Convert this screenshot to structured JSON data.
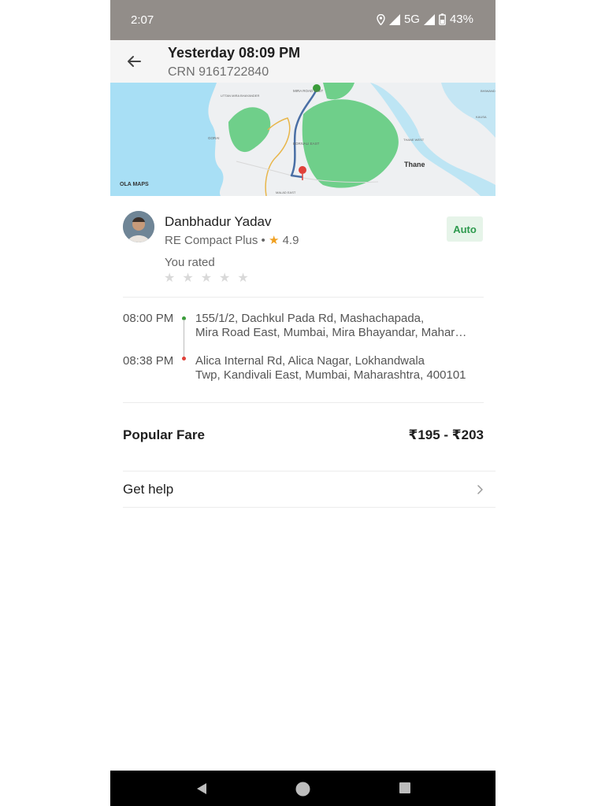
{
  "status_bar": {
    "time": "2:07",
    "network": "5G",
    "battery": "43%"
  },
  "header": {
    "title": "Yesterday 08:09 PM",
    "crn": "CRN 9161722840"
  },
  "map": {
    "brand": "OLA MAPS",
    "city_label": "Thane",
    "place_labels": [
      "MIRA ROAD EAST",
      "UTTAN MIRA BHAYANDER",
      "GORAI",
      "BORIVALI EAST",
      "THANE WEST",
      "MALAD EAST",
      "KAUSA",
      "BHIWANDI"
    ],
    "colors": {
      "water": "#a8dff5",
      "forest": "#6fcf8a",
      "land": "#eef0f2",
      "route": "#4a6fa5",
      "start": "#3a9c3a",
      "end": "#e0413a"
    }
  },
  "driver": {
    "name": "Danbhadur Yadav",
    "vehicle": "RE Compact Plus",
    "rating": "4.9",
    "badge": "Auto",
    "you_rated": "You rated",
    "stars_given": 0,
    "stars_total": 5
  },
  "trip": {
    "pickup": {
      "time": "08:00 PM",
      "address": "155/1/2, Dachkul Pada Rd, Mashachapada, Mira Road East, Mumbai, Mira Bhayandar, Maharashtra"
    },
    "drop": {
      "time": "08:38 PM",
      "address": "Alica Internal Rd, Alica Nagar, Lokhandwala Twp, Kandivali East, Mumbai, Maharashtra, 400101"
    }
  },
  "fare": {
    "label": "Popular Fare",
    "value": "₹195 - ₹203"
  },
  "help": {
    "label": "Get help"
  }
}
